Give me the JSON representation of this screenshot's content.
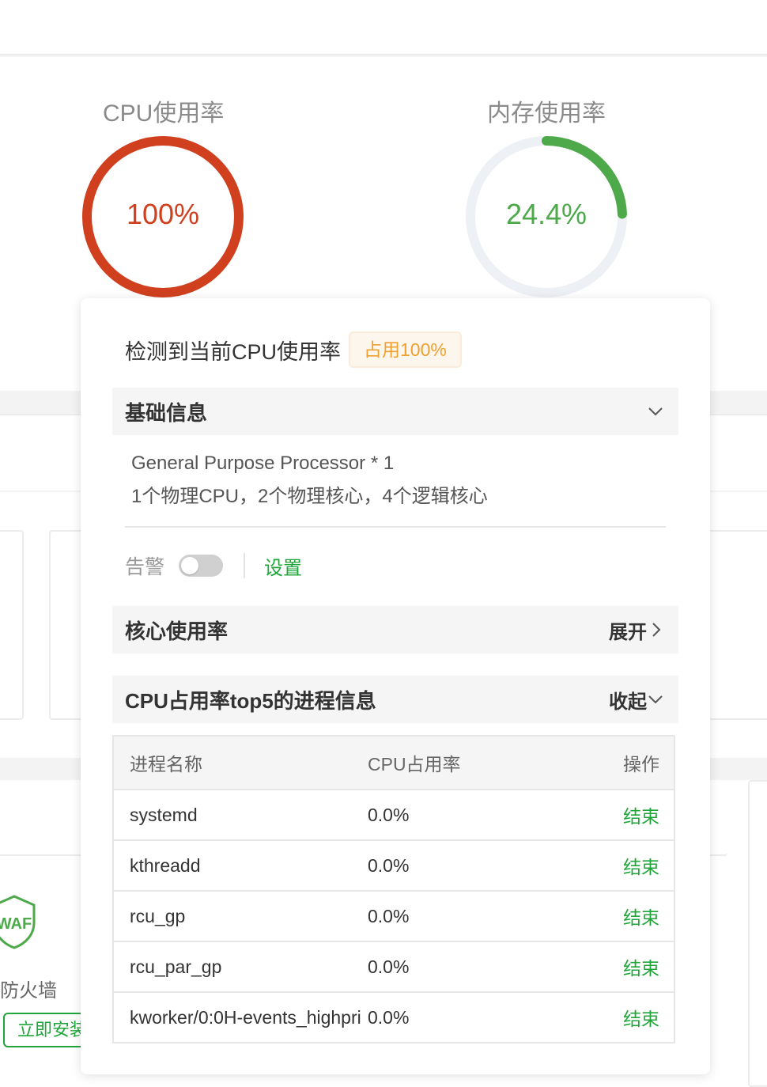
{
  "gauges": {
    "cpu": {
      "title": "CPU使用率",
      "value": "100%",
      "percent": 100,
      "color": "#d0401f"
    },
    "memory": {
      "title": "内存使用率",
      "value": "24.4%",
      "percent": 24.4,
      "color": "#4da94a"
    }
  },
  "popover": {
    "header": "检测到当前CPU使用率",
    "usage_tag": "占用100%",
    "basic_section": {
      "title": "基础信息"
    },
    "processor": "General Purpose Processor * 1",
    "topology": "1个物理CPU，2个物理核心，4个逻辑核心",
    "alert": {
      "label": "告警",
      "enabled": false,
      "settings_link": "设置"
    },
    "core_section": {
      "title": "核心使用率",
      "action": "展开"
    },
    "top5_section": {
      "title": "CPU占用率top5的进程信息",
      "action": "收起"
    },
    "table": {
      "headers": [
        "进程名称",
        "CPU占用率",
        "操作"
      ],
      "rows": [
        {
          "name": "systemd",
          "cpu": "0.0%",
          "action": "结束"
        },
        {
          "name": "kthreadd",
          "cpu": "0.0%",
          "action": "结束"
        },
        {
          "name": "rcu_gp",
          "cpu": "0.0%",
          "action": "结束"
        },
        {
          "name": "rcu_par_gp",
          "cpu": "0.0%",
          "action": "结束"
        },
        {
          "name": "kworker/0:0H-events_highpri",
          "cpu": "0.0%",
          "action": "结束"
        }
      ]
    }
  },
  "background": {
    "waf_badge": "WAF",
    "waf_label": "防火墙",
    "install_button": "立即安装"
  }
}
